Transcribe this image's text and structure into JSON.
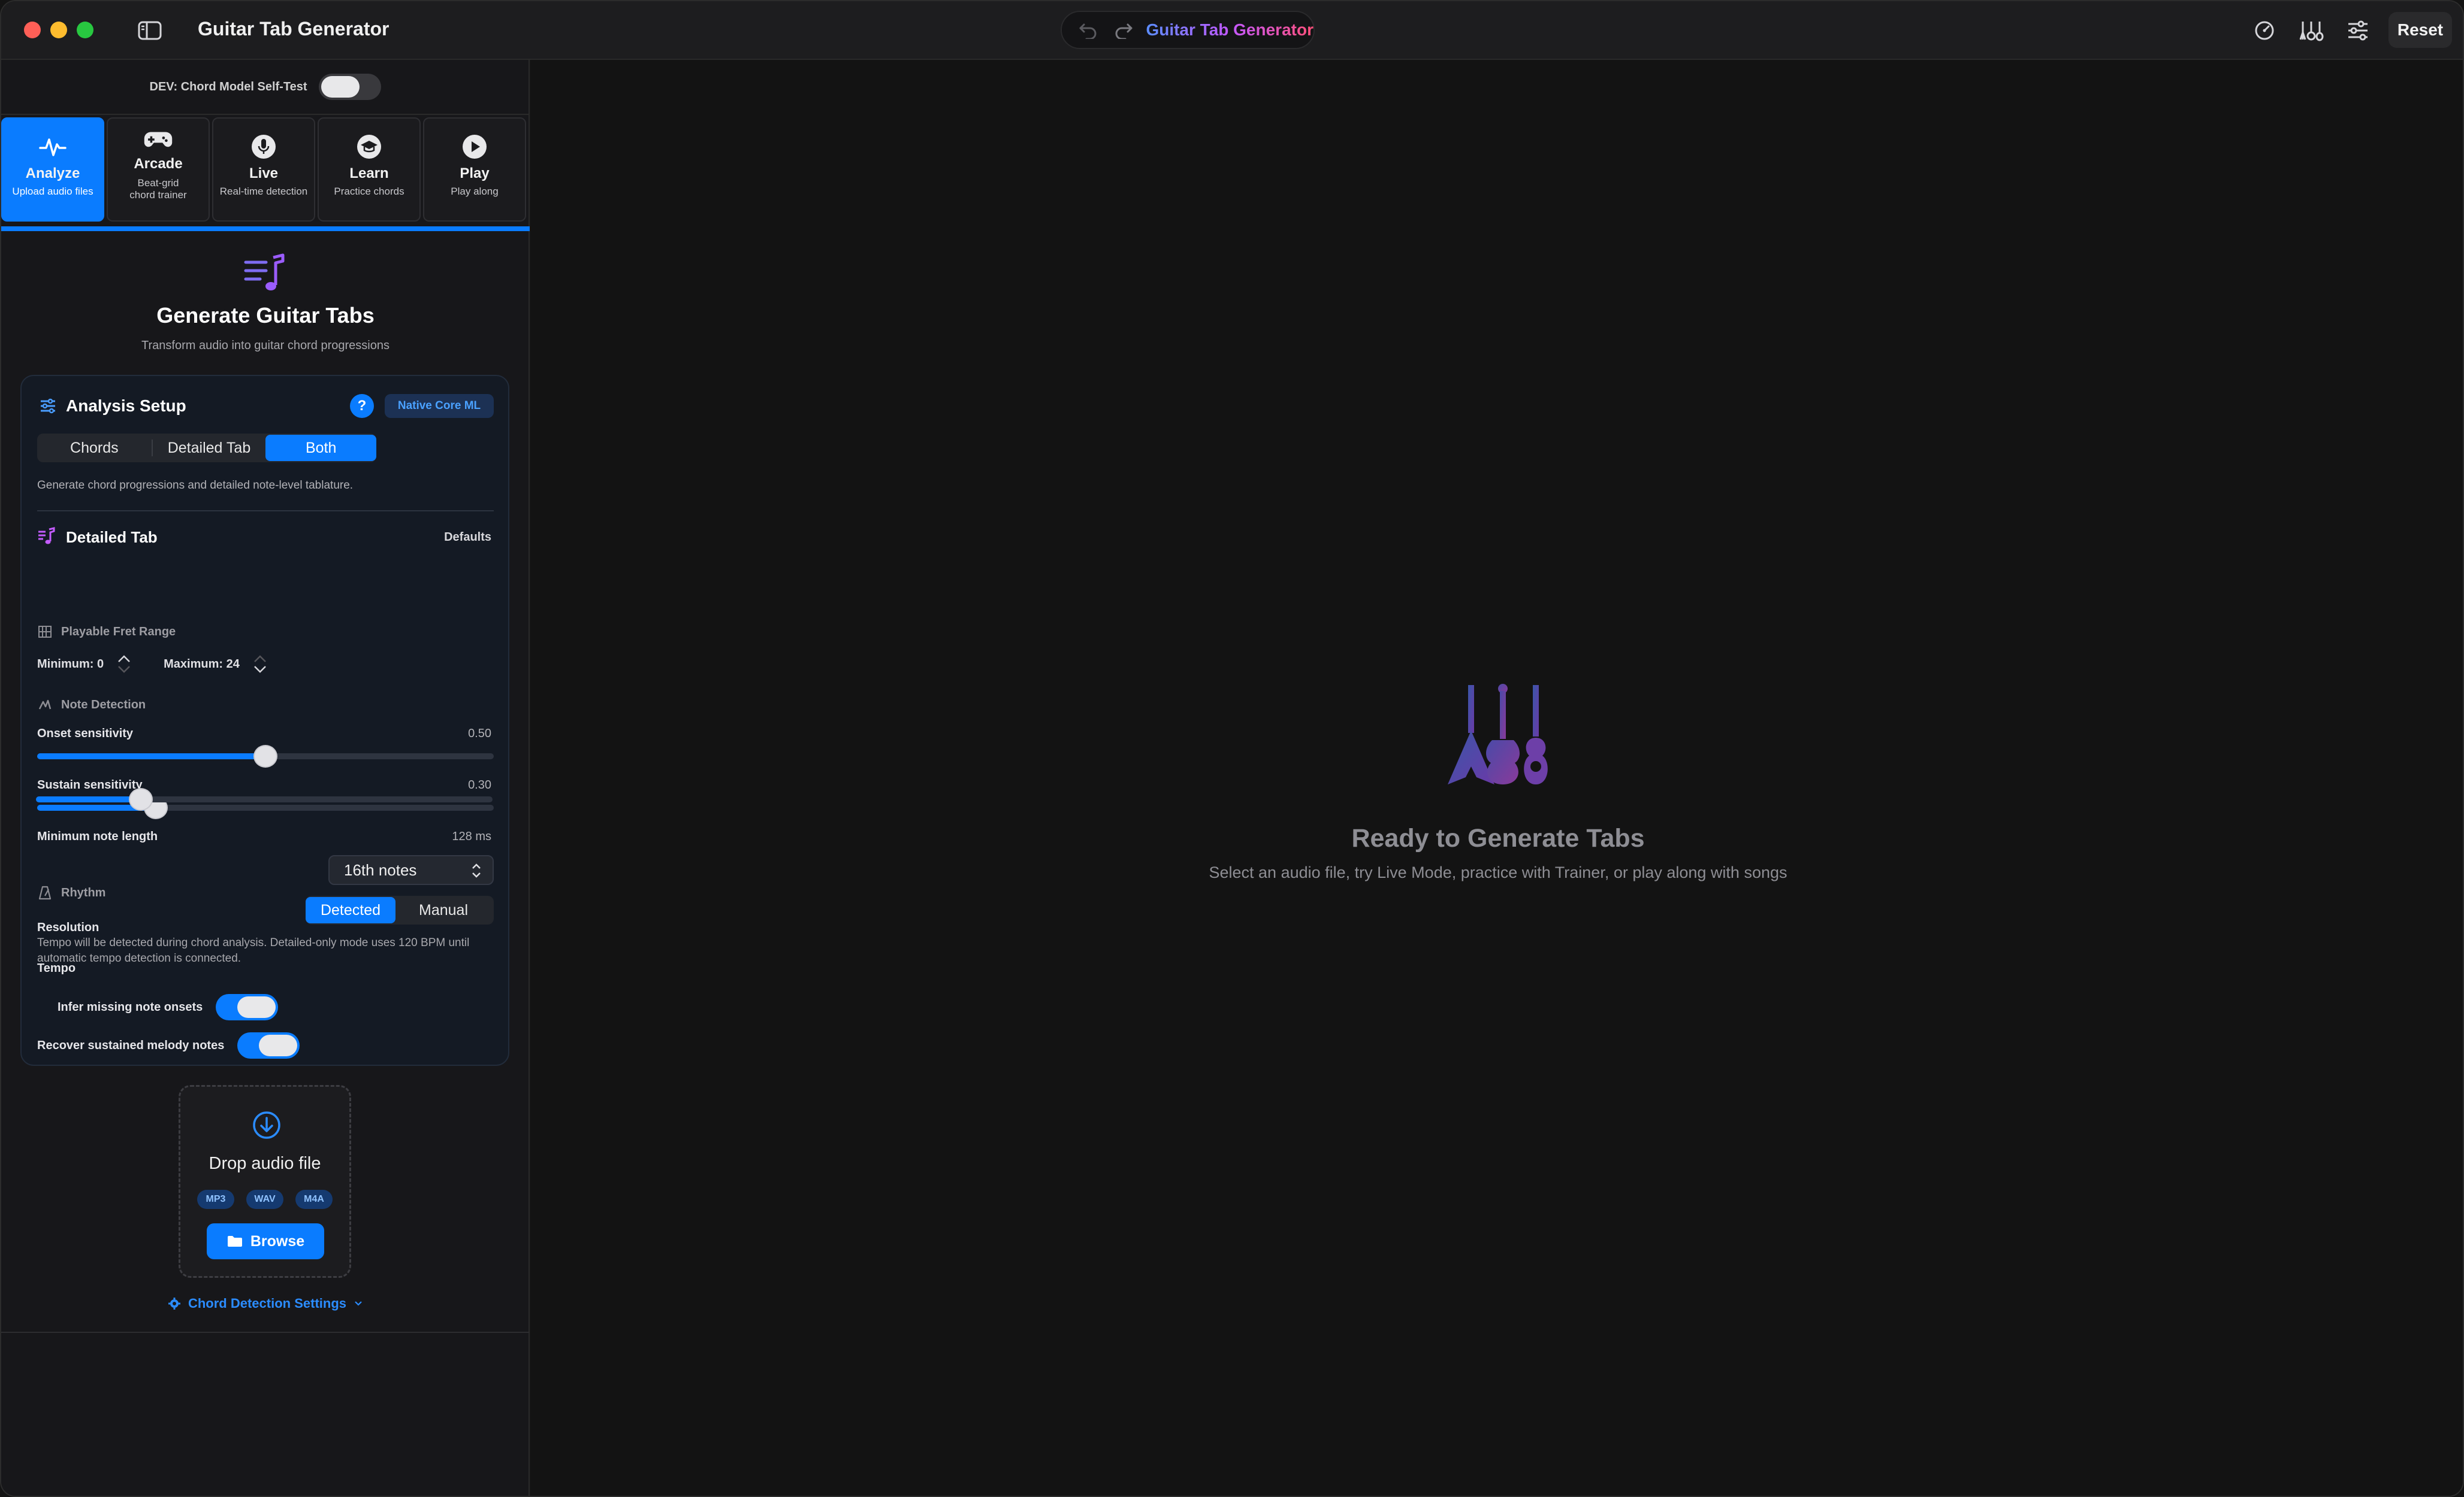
{
  "window": {
    "title": "Guitar Tab Generator",
    "center_title": "Guitar Tab Generator",
    "reset_label": "Reset"
  },
  "dev": {
    "label": "DEV: Chord Model Self-Test",
    "enabled": false
  },
  "modes": [
    {
      "name": "Analyze",
      "sub": "Upload audio files",
      "icon": "waveform-icon",
      "active": true
    },
    {
      "name": "Arcade",
      "sub": "Beat-grid chord trainer",
      "sub_lines": [
        "Beat-grid",
        "chord trainer"
      ],
      "icon": "gamepad-icon",
      "active": false
    },
    {
      "name": "Live",
      "sub": "Real-time detection",
      "icon": "microphone-icon",
      "active": false
    },
    {
      "name": "Learn",
      "sub": "Practice chords",
      "icon": "graduation-cap-icon",
      "active": false
    },
    {
      "name": "Play",
      "sub": "Play along",
      "icon": "play-circle-icon",
      "active": false
    }
  ],
  "hero": {
    "title": "Generate Guitar Tabs",
    "subtitle": "Transform audio into guitar chord progressions"
  },
  "analysis": {
    "title": "Analysis Setup",
    "help": "?",
    "badge": "Native Core ML",
    "segments": [
      "Chords",
      "Detailed Tab",
      "Both"
    ],
    "selected_segment": "Both",
    "description": "Generate chord progressions and detailed note-level tablature."
  },
  "detailed_tab": {
    "title": "Detailed Tab",
    "defaults_label": "Defaults",
    "fret_range": {
      "heading": "Playable Fret Range",
      "min_label": "Minimum: 0",
      "max_label": "Maximum: 24",
      "min": 0,
      "max": 24
    },
    "note_detection": {
      "heading": "Note Detection",
      "sliders": [
        {
          "label": "Onset sensitivity",
          "value_text": "0.50",
          "fraction": 0.5
        },
        {
          "label": "Sustain sensitivity",
          "value_text": "0.30",
          "fraction": 0.26
        },
        {
          "label": "Minimum note length",
          "value_text": "128 ms",
          "fraction": 0.23
        }
      ]
    },
    "rhythm": {
      "heading": "Rhythm",
      "resolution_label": "Resolution",
      "resolution_value": "16th notes",
      "tempo_label": "Tempo",
      "tempo_options": [
        "Detected",
        "Manual"
      ],
      "tempo_selected": "Detected",
      "tempo_note": "Tempo will be detected during chord analysis. Detailed-only mode uses 120 BPM until automatic tempo detection is connected."
    },
    "toggles": [
      {
        "label": "Infer missing note onsets",
        "on": true
      },
      {
        "label": "Recover sustained melody notes",
        "on": true
      }
    ]
  },
  "drop": {
    "title": "Drop audio file",
    "formats": [
      "MP3",
      "WAV",
      "M4A"
    ],
    "browse_label": "Browse"
  },
  "chord_settings_label": "Chord Detection Settings",
  "empty_state": {
    "title": "Ready to Generate Tabs",
    "subtitle": "Select an audio file, try Live Mode, practice with Trainer, or play along with songs"
  },
  "colors": {
    "accent": "#0a7cff",
    "purple": "#8e5cff",
    "pink": "#ff4f7a"
  }
}
